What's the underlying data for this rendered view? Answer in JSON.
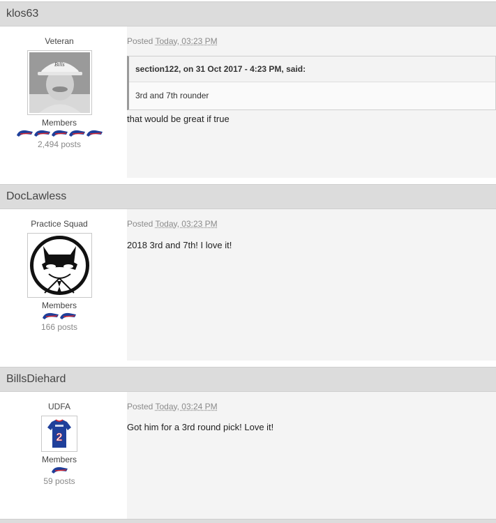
{
  "posts": [
    {
      "author": "klos63",
      "rank": "Veteran",
      "group": "Members",
      "posts_count": "2,494 posts",
      "pips": 5,
      "posted_prefix": "Posted",
      "posted_time": "Today, 03:23 PM",
      "quote": {
        "citation": "section122, on 31 Oct 2017 - 4:23 PM, said:",
        "text": "3rd and 7th rounder"
      },
      "content": "that would be great if true"
    },
    {
      "author": "DocLawless",
      "rank": "Practice Squad",
      "group": "Members",
      "posts_count": "166 posts",
      "pips": 2,
      "posted_prefix": "Posted",
      "posted_time": "Today, 03:23 PM",
      "content": "2018 3rd and 7th! I love it!"
    },
    {
      "author": "BillsDiehard",
      "rank": "UDFA",
      "group": "Members",
      "posts_count": "59 posts",
      "pips": 1,
      "posted_prefix": "Posted",
      "posted_time": "Today, 03:24 PM",
      "content": "Got him for a 3rd round pick! Love it!",
      "jersey_text": "2"
    }
  ],
  "colors": {
    "header_bg": "#dcdcdc",
    "body_bg": "#f4f4f4",
    "pip_blue": "#1f3f9a",
    "pip_red": "#d22630"
  },
  "icons": {
    "rank_pip": "bills-buffalo-icon"
  }
}
